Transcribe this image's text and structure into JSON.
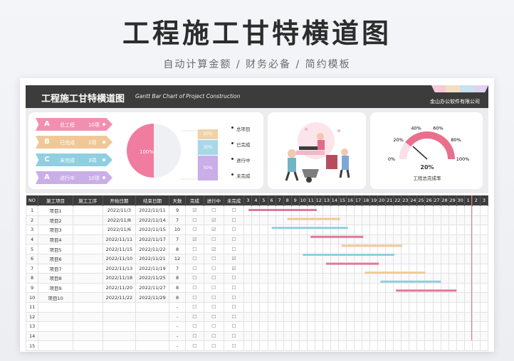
{
  "hero": {
    "title": "工程施工甘特横道图",
    "subtitle": "自动计算金额 / 财务必备 / 简约模板"
  },
  "banner": {
    "title": "工程施工甘特横道图",
    "subtitle_en": "Gantt Bar Chart of Project Construction",
    "company": "金山办公软件有限公司"
  },
  "summary_tags": [
    {
      "abbr": "A",
      "label": "总工程",
      "count": "10项",
      "color": "#f28fb1"
    },
    {
      "abbr": "B",
      "label": "已完成",
      "count": "2项",
      "color": "#f0c898"
    },
    {
      "abbr": "C",
      "label": "未完成",
      "count": "3项",
      "color": "#8fcfe0"
    },
    {
      "abbr": "A",
      "label": "进行中",
      "count": "10项",
      "color": "#c9aee8"
    }
  ],
  "pie": {
    "label": "100%",
    "value": 100
  },
  "stack": [
    {
      "label": "20%",
      "value": 20,
      "color": "#f0d2a8"
    },
    {
      "label": "30%",
      "value": 30,
      "color": "#a8d8e8"
    },
    {
      "label": "50%",
      "value": 50,
      "color": "#c9aee8"
    }
  ],
  "stack_legend": [
    "总项目",
    "已完成",
    "进行中",
    "未完成"
  ],
  "gauge": {
    "value": "20%",
    "caption": "工程总完成率",
    "ticks": [
      "0%",
      "20%",
      "40%",
      "60%",
      "80%",
      "100%"
    ],
    "color": "#ea6f8d"
  },
  "table": {
    "headers": [
      "NO",
      "施工项目",
      "施工工序",
      "开始日期",
      "结束日期",
      "天数",
      "完成",
      "进行中",
      "未完成"
    ],
    "days": [
      "3",
      "4",
      "5",
      "6",
      "7",
      "8",
      "9",
      "10",
      "11",
      "12",
      "13",
      "14",
      "15",
      "16",
      "17",
      "18",
      "19",
      "20",
      "21",
      "22",
      "23",
      "24",
      "25",
      "26",
      "27",
      "28",
      "29",
      "30",
      "1",
      "2",
      "3"
    ],
    "rows": [
      {
        "no": "1",
        "name": "项目1",
        "proc": "",
        "start": "2022/11/3",
        "end": "2022/11/11",
        "days": "9",
        "c1": "☑",
        "c2": "☐",
        "c3": "☐",
        "s": 3,
        "e": 11,
        "color": "#e0789e"
      },
      {
        "no": "2",
        "name": "项目2",
        "proc": "",
        "start": "2022/11/8",
        "end": "2022/11/14",
        "days": "7",
        "c1": "☐",
        "c2": "☑",
        "c3": "☐",
        "s": 8,
        "e": 14,
        "color": "#f0c898"
      },
      {
        "no": "3",
        "name": "项目3",
        "proc": "",
        "start": "2022/11/6",
        "end": "2022/11/15",
        "days": "10",
        "c1": "☐",
        "c2": "☑",
        "c3": "☐",
        "s": 6,
        "e": 15,
        "color": "#8fcfe0"
      },
      {
        "no": "4",
        "name": "项目4",
        "proc": "",
        "start": "2022/11/11",
        "end": "2022/11/17",
        "days": "7",
        "c1": "☑",
        "c2": "☐",
        "c3": "☐",
        "s": 11,
        "e": 17,
        "color": "#e0789e"
      },
      {
        "no": "5",
        "name": "项目5",
        "proc": "",
        "start": "2022/11/15",
        "end": "2022/11/22",
        "days": "8",
        "c1": "☐",
        "c2": "☑",
        "c3": "☐",
        "s": 15,
        "e": 22,
        "color": "#f0c898"
      },
      {
        "no": "6",
        "name": "项目6",
        "proc": "",
        "start": "2022/11/10",
        "end": "2022/11/21",
        "days": "12",
        "c1": "☐",
        "c2": "☐",
        "c3": "☑",
        "s": 10,
        "e": 21,
        "color": "#8fcfe0"
      },
      {
        "no": "7",
        "name": "项目7",
        "proc": "",
        "start": "2022/11/13",
        "end": "2022/11/19",
        "days": "7",
        "c1": "☐",
        "c2": "☐",
        "c3": "☑",
        "s": 13,
        "e": 19,
        "color": "#e0789e"
      },
      {
        "no": "8",
        "name": "项目8",
        "proc": "",
        "start": "2022/11/18",
        "end": "2022/11/25",
        "days": "8",
        "c1": "☐",
        "c2": "☐",
        "c3": "☐",
        "s": 18,
        "e": 25,
        "color": "#f0c898"
      },
      {
        "no": "9",
        "name": "项目9",
        "proc": "",
        "start": "2022/11/20",
        "end": "2022/11/27",
        "days": "8",
        "c1": "☐",
        "c2": "☐",
        "c3": "☐",
        "s": 20,
        "e": 27,
        "color": "#8fcfe0"
      },
      {
        "no": "10",
        "name": "项目10",
        "proc": "",
        "start": "2022/11/22",
        "end": "2022/11/29",
        "days": "8",
        "c1": "☐",
        "c2": "☐",
        "c3": "☐",
        "s": 22,
        "e": 29,
        "color": "#e0789e"
      },
      {
        "no": "11",
        "name": "",
        "proc": "",
        "start": "",
        "end": "",
        "days": "-",
        "c1": "☐",
        "c2": "☐",
        "c3": "☐"
      },
      {
        "no": "12",
        "name": "",
        "proc": "",
        "start": "",
        "end": "",
        "days": "-",
        "c1": "☐",
        "c2": "☐",
        "c3": "☐"
      },
      {
        "no": "13",
        "name": "",
        "proc": "",
        "start": "",
        "end": "",
        "days": "-",
        "c1": "☐",
        "c2": "☐",
        "c3": "☐"
      },
      {
        "no": "14",
        "name": "",
        "proc": "",
        "start": "",
        "end": "",
        "days": "-",
        "c1": "☐",
        "c2": "☐",
        "c3": "☐"
      },
      {
        "no": "15",
        "name": "",
        "proc": "",
        "start": "",
        "end": "",
        "days": "-",
        "c1": "☐",
        "c2": "☐",
        "c3": "☐"
      }
    ]
  }
}
